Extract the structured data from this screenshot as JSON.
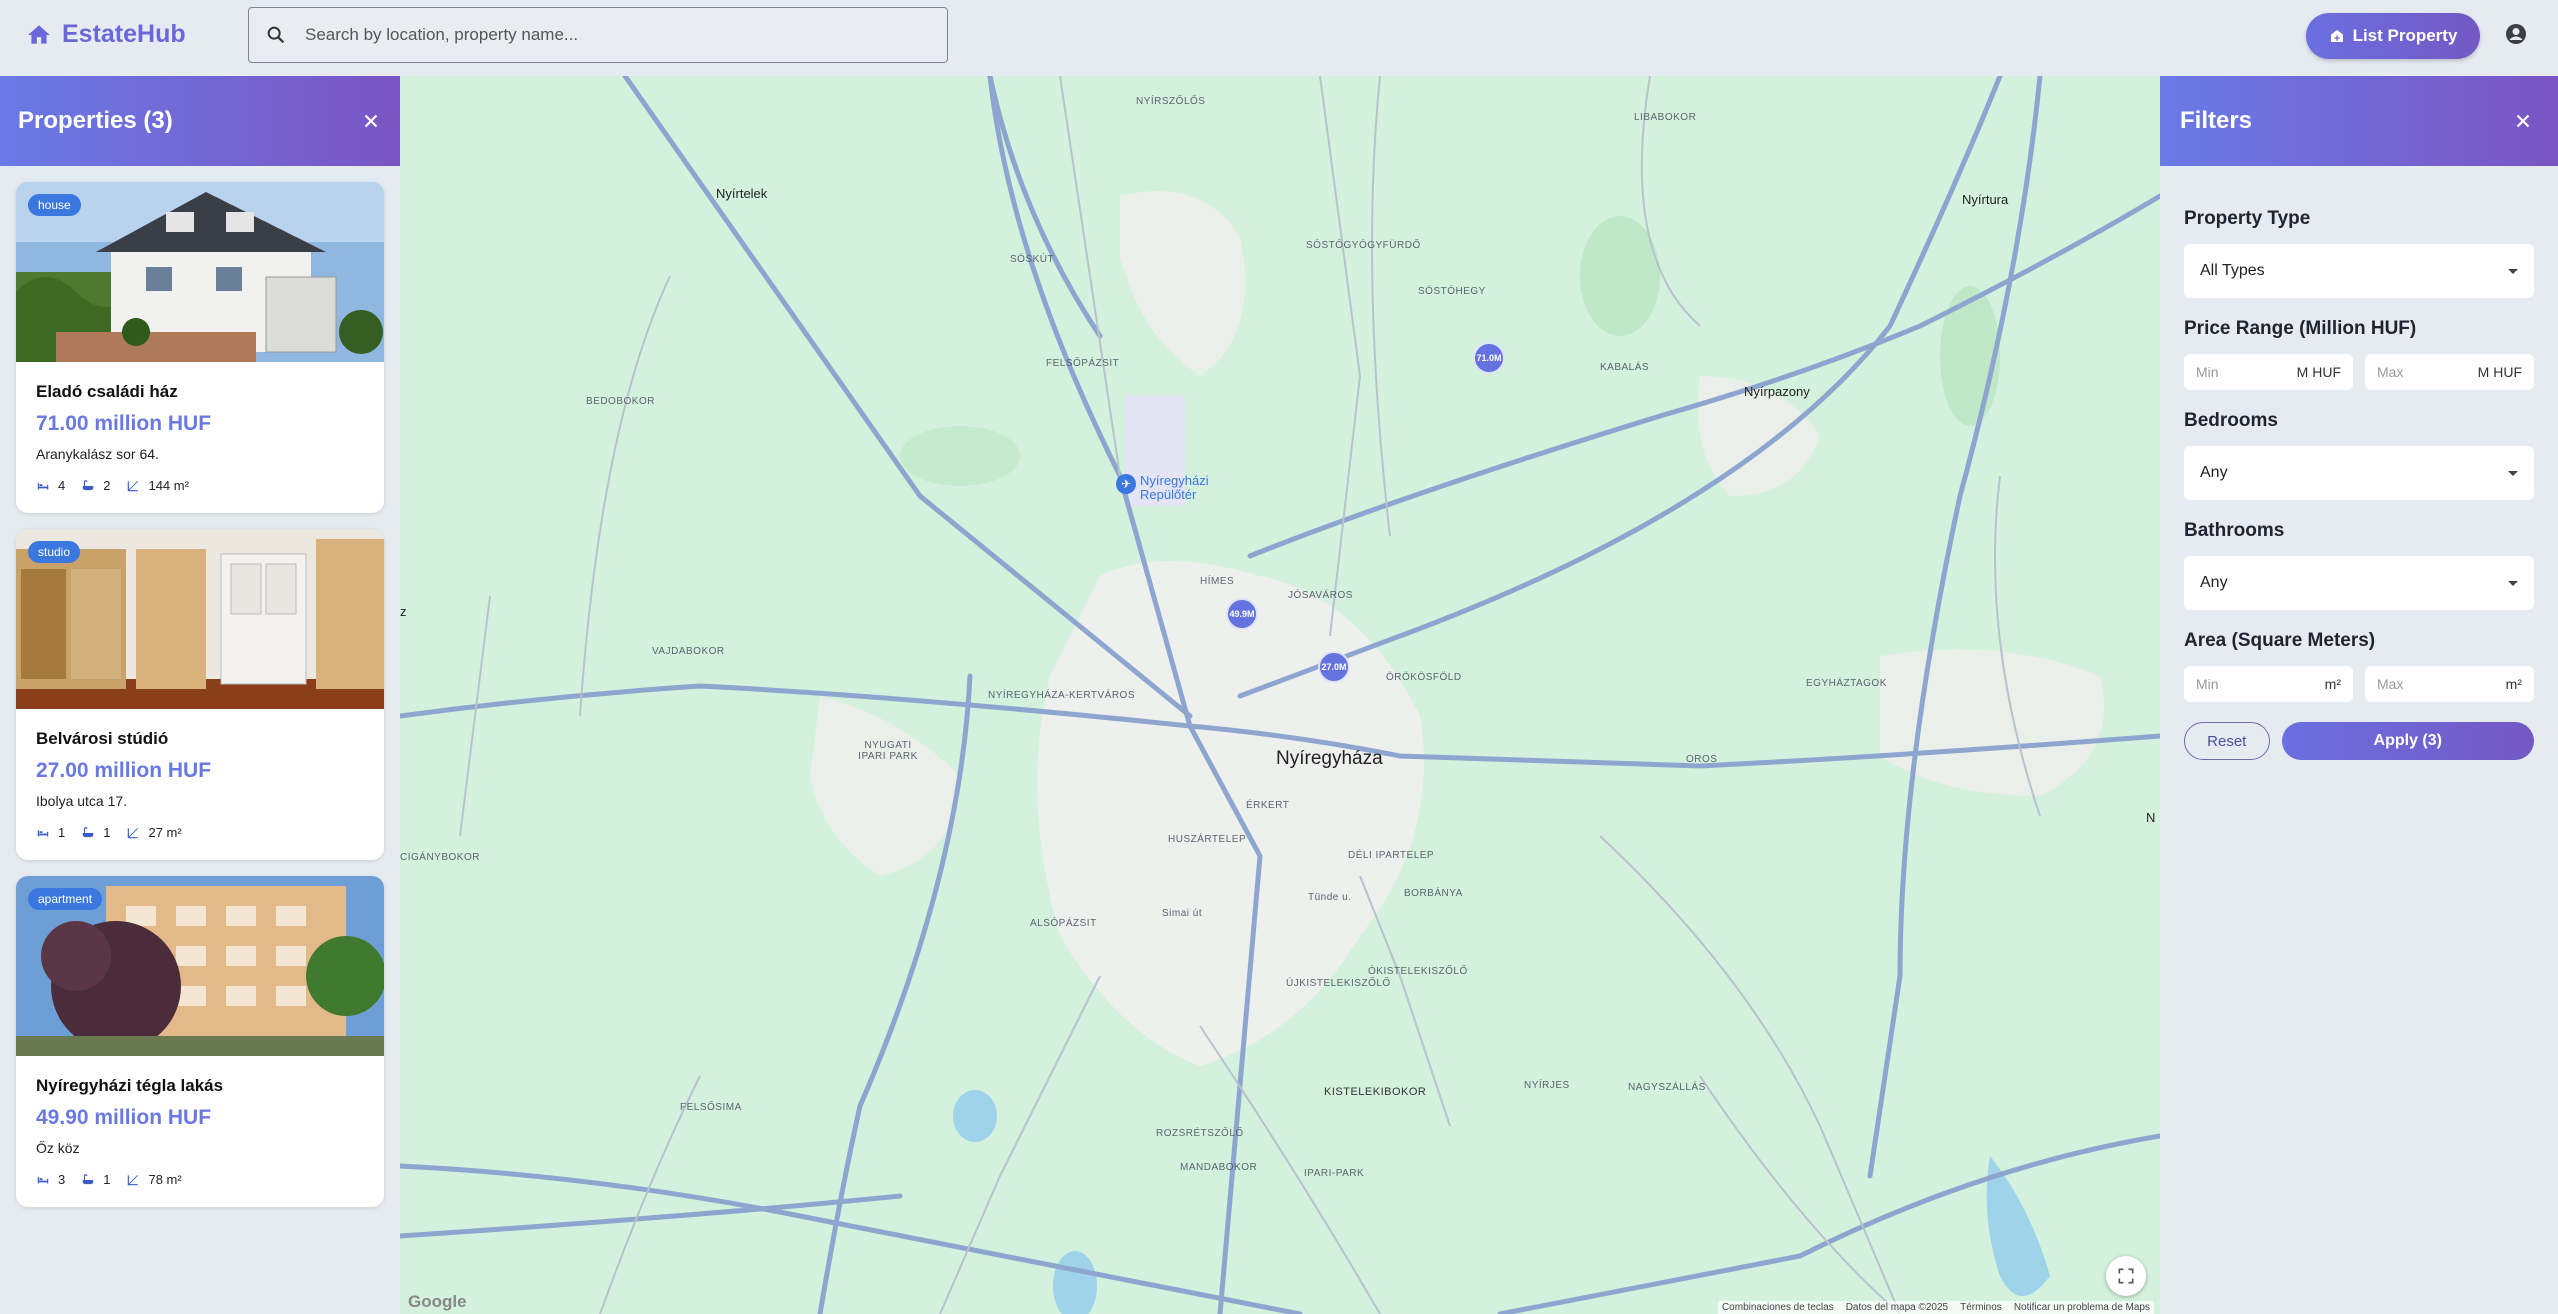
{
  "header": {
    "logo_text": "EstateHub",
    "search_placeholder": "Search by location, property name...",
    "list_button_label": "List Property"
  },
  "properties_panel": {
    "title": "Properties (3)",
    "items": [
      {
        "type": "house",
        "name": "Eladó családi ház",
        "price": "71.00 million HUF",
        "address": "Aranykalász sor 64.",
        "bedrooms": "4",
        "bathrooms": "2",
        "area": "144 m²"
      },
      {
        "type": "studio",
        "name": "Belvárosi stúdió",
        "price": "27.00 million HUF",
        "address": "Ibolya utca 17.",
        "bedrooms": "1",
        "bathrooms": "1",
        "area": "27 m²"
      },
      {
        "type": "apartment",
        "name": "Nyíregyházi tégla lakás",
        "price": "49.90 million HUF",
        "address": "Őz köz",
        "bedrooms": "3",
        "bathrooms": "1",
        "area": "78 m²"
      }
    ]
  },
  "map": {
    "city": "Nyíregyháza",
    "pins": [
      "71.0M",
      "49.9M",
      "27.0M"
    ],
    "airport": "Nyíregyházi Repülőtér",
    "google": "Google",
    "footer": [
      "Combinaciones de teclas",
      "Datos del mapa ©2025",
      "Términos",
      "Notificar un problema de Maps"
    ],
    "labels": {
      "nyirtelek": "Nyírtelek",
      "nyirtura": "Nyírtura",
      "nyirpazony": "Nyírpazony",
      "bedobokor": "BEDOBOKOR",
      "vajdabokor": "VAJDABOKOR",
      "ciganybokor": "CIGÁNYBOKOR",
      "nyugati": "NYUGATI IPARI PARK",
      "also_pazsit": "ALSÓPÁZSIT",
      "felsopazsit": "FELSŐPÁZSIT",
      "sosto_gyogy": "SÓSTÓGYÓGYFÜRDŐ",
      "sostohegy": "SÓSTÓHEGY",
      "kabalas": "KABALÁS",
      "libabokor": "LIBABOKOR",
      "nyirszolos": "NYÍRSZŐLŐS",
      "soskut": "SÓSKÚT",
      "himes": "HÍMES",
      "josavaros": "JÓSAVÁROS",
      "orokosfold": "ÖRÖKÖSFÖLD",
      "kertvaros": "NYÍREGYHÁZA-KERTVÁROS",
      "egyhaztagok": "EGYHÁZTAGOK",
      "oros": "OROS",
      "erkert": "ÉRKERT",
      "huszartelep": "HUSZÁRTELEP",
      "deli": "DÉLI IPARTELEP",
      "borbanya": "BORBÁNYA",
      "tunde": "Tünde u.",
      "simai": "Simai út",
      "okistelek": "ÓKISTELEKISZŐLŐ",
      "ujkistelek": "ÚJKISTELEKISZŐLŐ",
      "kistelekibokor": "KISTELEKIBOKOR",
      "nyirjes": "NYÍRJES",
      "nagyszallas": "NAGYSZÁLLÁS",
      "felsosima": "FELSŐSIMA",
      "rozsretszolo": "ROZSRÉTSZŐLŐ",
      "mandabokor": "MANDABOKOR",
      "ipari_park": "IPARI-PARK",
      "edge_n": "N",
      "edge_z": "z"
    }
  },
  "filters": {
    "title": "Filters",
    "property_type_label": "Property Type",
    "property_type_value": "All Types",
    "price_label": "Price Range (Million HUF)",
    "price_min_placeholder": "Min",
    "price_max_placeholder": "Max",
    "price_unit": "M HUF",
    "bedrooms_label": "Bedrooms",
    "bedrooms_value": "Any",
    "bathrooms_label": "Bathrooms",
    "bathrooms_value": "Any",
    "area_label": "Area (Square Meters)",
    "area_min_placeholder": "Min",
    "area_max_placeholder": "Max",
    "area_unit": "m²",
    "reset_label": "Reset",
    "apply_label": "Apply (3)"
  },
  "colors": {
    "brand": "#6a67d8",
    "accent_gradient_start": "#6b6fe0",
    "accent_gradient_end": "#7458c4",
    "price": "#6a78e2",
    "badge": "#3a78e0"
  }
}
